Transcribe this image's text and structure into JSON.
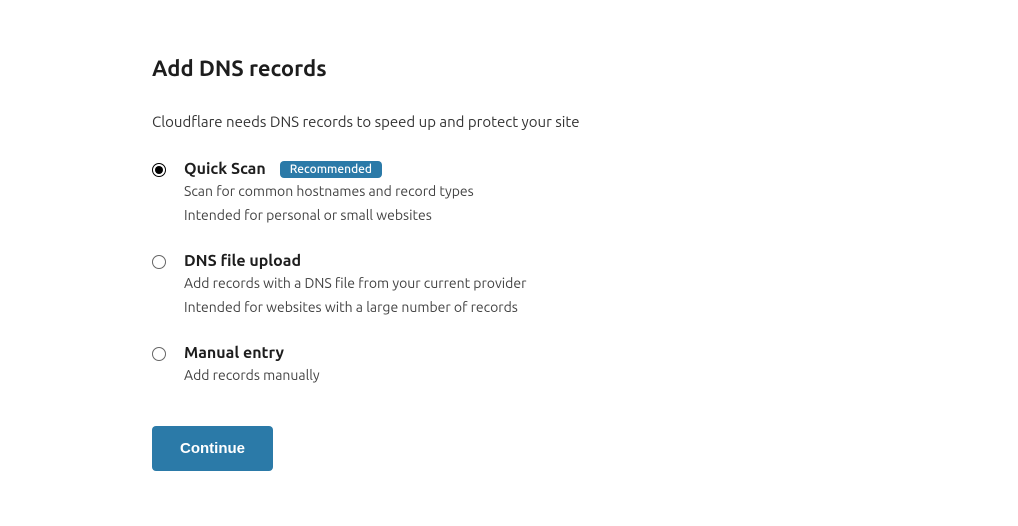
{
  "page": {
    "title": "Add DNS records",
    "subtitle": "Cloudflare needs DNS records to speed up and protect your site"
  },
  "options": [
    {
      "id": "quick-scan",
      "title": "Quick Scan",
      "badge": "Recommended",
      "desc1": "Scan for common hostnames and record types",
      "desc2": "Intended for personal or small websites",
      "selected": true
    },
    {
      "id": "dns-file-upload",
      "title": "DNS file upload",
      "badge": null,
      "desc1": "Add records with a DNS file from your current provider",
      "desc2": "Intended for websites with a large number of records",
      "selected": false
    },
    {
      "id": "manual-entry",
      "title": "Manual entry",
      "badge": null,
      "desc1": "Add records manually",
      "desc2": null,
      "selected": false
    }
  ],
  "actions": {
    "continue_label": "Continue"
  },
  "colors": {
    "accent": "#2b7aa8"
  }
}
